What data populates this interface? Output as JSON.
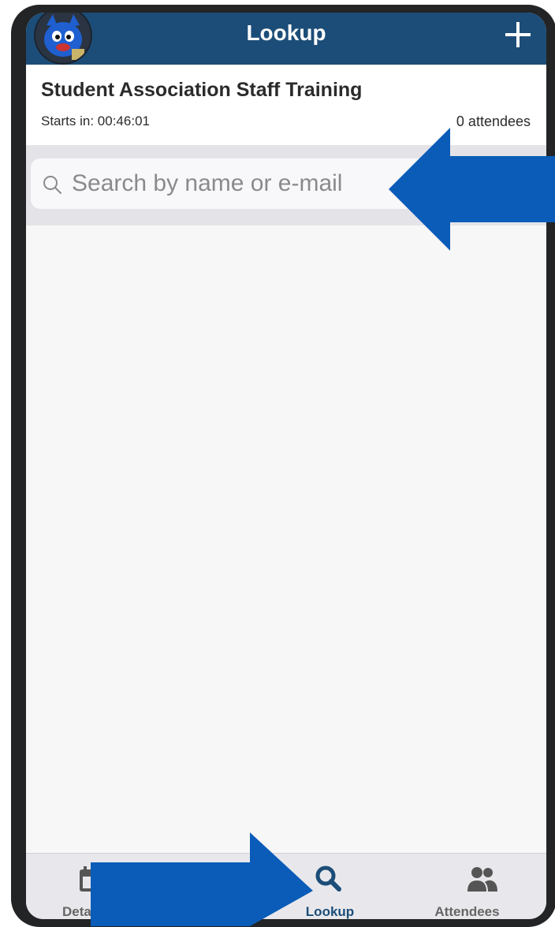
{
  "nav": {
    "title": "Lookup",
    "add_icon": "plus-icon",
    "avatar_icon": "mascot-avatar"
  },
  "event": {
    "title": "Student Association Staff Training",
    "starts_in": "Starts in: 00:46:01",
    "attendees": "0 attendees"
  },
  "search": {
    "placeholder": "Search by name or e-mail",
    "icon": "search-icon"
  },
  "tabs": [
    {
      "label": "Deta",
      "icon": "calendar-icon",
      "active": false
    },
    {
      "label": "",
      "icon": "qr-icon",
      "active": false
    },
    {
      "label": "Lookup",
      "icon": "search-icon",
      "active": true
    },
    {
      "label": "Attendees",
      "icon": "people-icon",
      "active": false
    }
  ],
  "colors": {
    "nav_background": "#1c4d78",
    "annotation_arrow": "#0a5cb8",
    "active_tab": "#1c4d78"
  }
}
